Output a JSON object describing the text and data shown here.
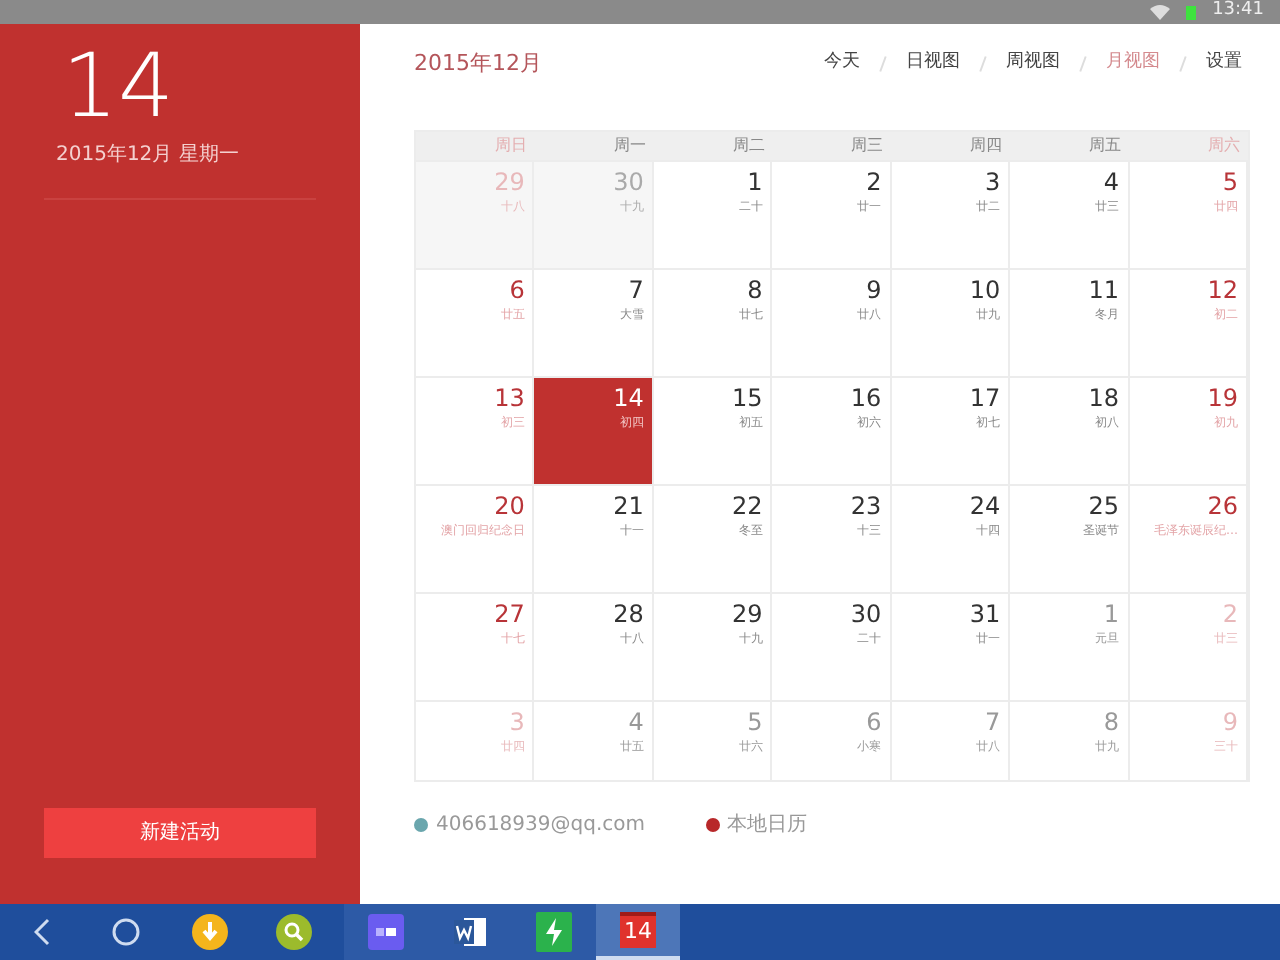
{
  "status_bar": {
    "time": "13:41"
  },
  "sidebar": {
    "day": "14",
    "date": "2015年12月 星期一",
    "new_button": "新建活动"
  },
  "header": {
    "title": "2015年12月"
  },
  "tabs": [
    {
      "label": "今天",
      "selected": false
    },
    {
      "label": "日视图",
      "selected": false
    },
    {
      "label": "周视图",
      "selected": false
    },
    {
      "label": "月视图",
      "selected": true
    },
    {
      "label": "设置",
      "selected": false
    }
  ],
  "weekdays": [
    "周日",
    "周一",
    "周二",
    "周三",
    "周四",
    "周五",
    "周六"
  ],
  "weeks": [
    [
      {
        "day": "29",
        "lunar": "十八",
        "kind": "prev",
        "selected": false
      },
      {
        "day": "30",
        "lunar": "十九",
        "kind": "prev",
        "selected": false
      },
      {
        "day": "1",
        "lunar": "二十",
        "kind": "current",
        "selected": false
      },
      {
        "day": "2",
        "lunar": "廿一",
        "kind": "current",
        "selected": false
      },
      {
        "day": "3",
        "lunar": "廿二",
        "kind": "current",
        "selected": false
      },
      {
        "day": "4",
        "lunar": "廿三",
        "kind": "current",
        "selected": false
      },
      {
        "day": "5",
        "lunar": "廿四",
        "kind": "current",
        "selected": false
      }
    ],
    [
      {
        "day": "6",
        "lunar": "廿五",
        "kind": "current",
        "selected": false
      },
      {
        "day": "7",
        "lunar": "大雪",
        "kind": "current",
        "selected": false
      },
      {
        "day": "8",
        "lunar": "廿七",
        "kind": "current",
        "selected": false
      },
      {
        "day": "9",
        "lunar": "廿八",
        "kind": "current",
        "selected": false
      },
      {
        "day": "10",
        "lunar": "廿九",
        "kind": "current",
        "selected": false
      },
      {
        "day": "11",
        "lunar": "冬月",
        "kind": "current",
        "selected": false
      },
      {
        "day": "12",
        "lunar": "初二",
        "kind": "current",
        "selected": false
      }
    ],
    [
      {
        "day": "13",
        "lunar": "初三",
        "kind": "current",
        "selected": false
      },
      {
        "day": "14",
        "lunar": "初四",
        "kind": "current",
        "selected": true
      },
      {
        "day": "15",
        "lunar": "初五",
        "kind": "current",
        "selected": false
      },
      {
        "day": "16",
        "lunar": "初六",
        "kind": "current",
        "selected": false
      },
      {
        "day": "17",
        "lunar": "初七",
        "kind": "current",
        "selected": false
      },
      {
        "day": "18",
        "lunar": "初八",
        "kind": "current",
        "selected": false
      },
      {
        "day": "19",
        "lunar": "初九",
        "kind": "current",
        "selected": false
      }
    ],
    [
      {
        "day": "20",
        "lunar": "澳门回归纪念日",
        "kind": "current",
        "selected": false
      },
      {
        "day": "21",
        "lunar": "十一",
        "kind": "current",
        "selected": false
      },
      {
        "day": "22",
        "lunar": "冬至",
        "kind": "current",
        "selected": false
      },
      {
        "day": "23",
        "lunar": "十三",
        "kind": "current",
        "selected": false
      },
      {
        "day": "24",
        "lunar": "十四",
        "kind": "current",
        "selected": false
      },
      {
        "day": "25",
        "lunar": "圣诞节",
        "kind": "current",
        "selected": false
      },
      {
        "day": "26",
        "lunar": "毛泽东诞辰纪…",
        "kind": "current",
        "selected": false
      }
    ],
    [
      {
        "day": "27",
        "lunar": "十七",
        "kind": "current",
        "selected": false
      },
      {
        "day": "28",
        "lunar": "十八",
        "kind": "current",
        "selected": false
      },
      {
        "day": "29",
        "lunar": "十九",
        "kind": "current",
        "selected": false
      },
      {
        "day": "30",
        "lunar": "二十",
        "kind": "current",
        "selected": false
      },
      {
        "day": "31",
        "lunar": "廿一",
        "kind": "current",
        "selected": false
      },
      {
        "day": "1",
        "lunar": "元旦",
        "kind": "next",
        "selected": false
      },
      {
        "day": "2",
        "lunar": "廿三",
        "kind": "next",
        "selected": false
      }
    ],
    [
      {
        "day": "3",
        "lunar": "廿四",
        "kind": "next",
        "selected": false
      },
      {
        "day": "4",
        "lunar": "廿五",
        "kind": "next",
        "selected": false
      },
      {
        "day": "5",
        "lunar": "廿六",
        "kind": "next",
        "selected": false
      },
      {
        "day": "6",
        "lunar": "小寒",
        "kind": "next",
        "selected": false
      },
      {
        "day": "7",
        "lunar": "廿八",
        "kind": "next",
        "selected": false
      },
      {
        "day": "8",
        "lunar": "廿九",
        "kind": "next",
        "selected": false
      },
      {
        "day": "9",
        "lunar": "三十",
        "kind": "next",
        "selected": false
      }
    ]
  ],
  "calendars": [
    {
      "label": "406618939@qq.com",
      "color": "#6aa6ad"
    },
    {
      "label": "本地日历",
      "color": "#b8282a"
    }
  ],
  "taskbar": {
    "apps": [
      {
        "kind": "tiles",
        "selected": false
      },
      {
        "kind": "word",
        "selected": false
      },
      {
        "kind": "bolt",
        "selected": false
      },
      {
        "kind": "calendar",
        "label": "14",
        "selected": true
      }
    ]
  }
}
